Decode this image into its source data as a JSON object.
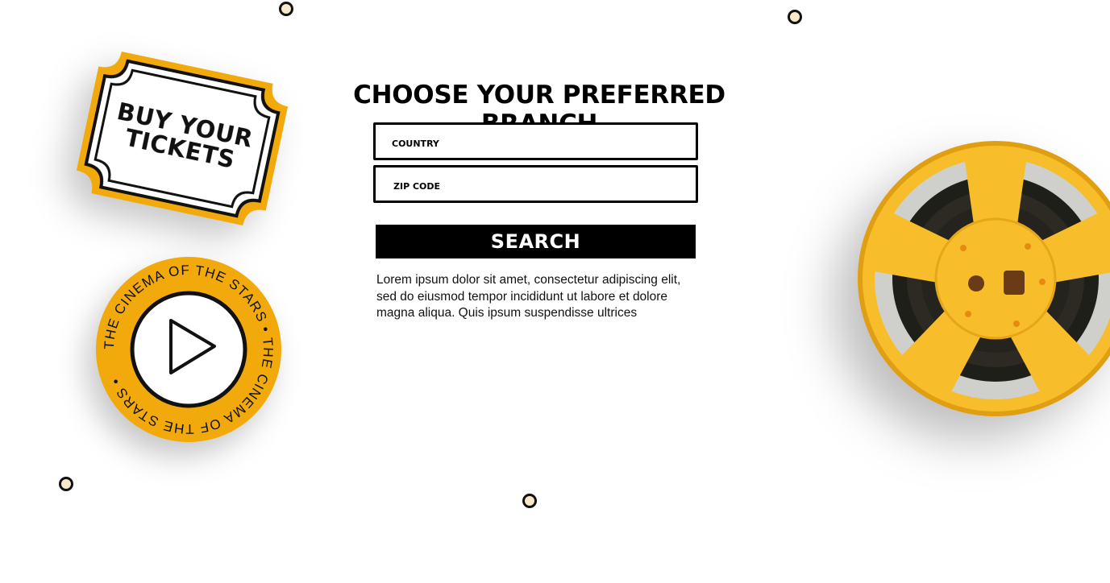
{
  "ticket": {
    "label_line1": "Buy your",
    "label_line2": "tickets"
  },
  "badge": {
    "ring_text": "THE CINEMA OF THE STARS  •  THE CINEMA OF THE STARS  •  "
  },
  "form": {
    "title": "Choose your preferred branch",
    "country": {
      "placeholder": "COUNTRY"
    },
    "zip": {
      "placeholder": "ZIP CODE"
    },
    "search_label": "SEARCH",
    "description": "Lorem ipsum dolor sit amet, consectetur adipiscing elit, sed do eiusmod tempor incididunt ut labore et dolore magna aliqua. Quis ipsum suspendisse ultrices"
  },
  "colors": {
    "accent": "#f1a90c",
    "reel_yellow": "#f7bd2a",
    "dot_fill": "#f6e8c9",
    "ink": "#000000"
  },
  "icons": {
    "ticket": "ticket-icon",
    "play": "play-icon",
    "reel": "film-reel-image"
  }
}
